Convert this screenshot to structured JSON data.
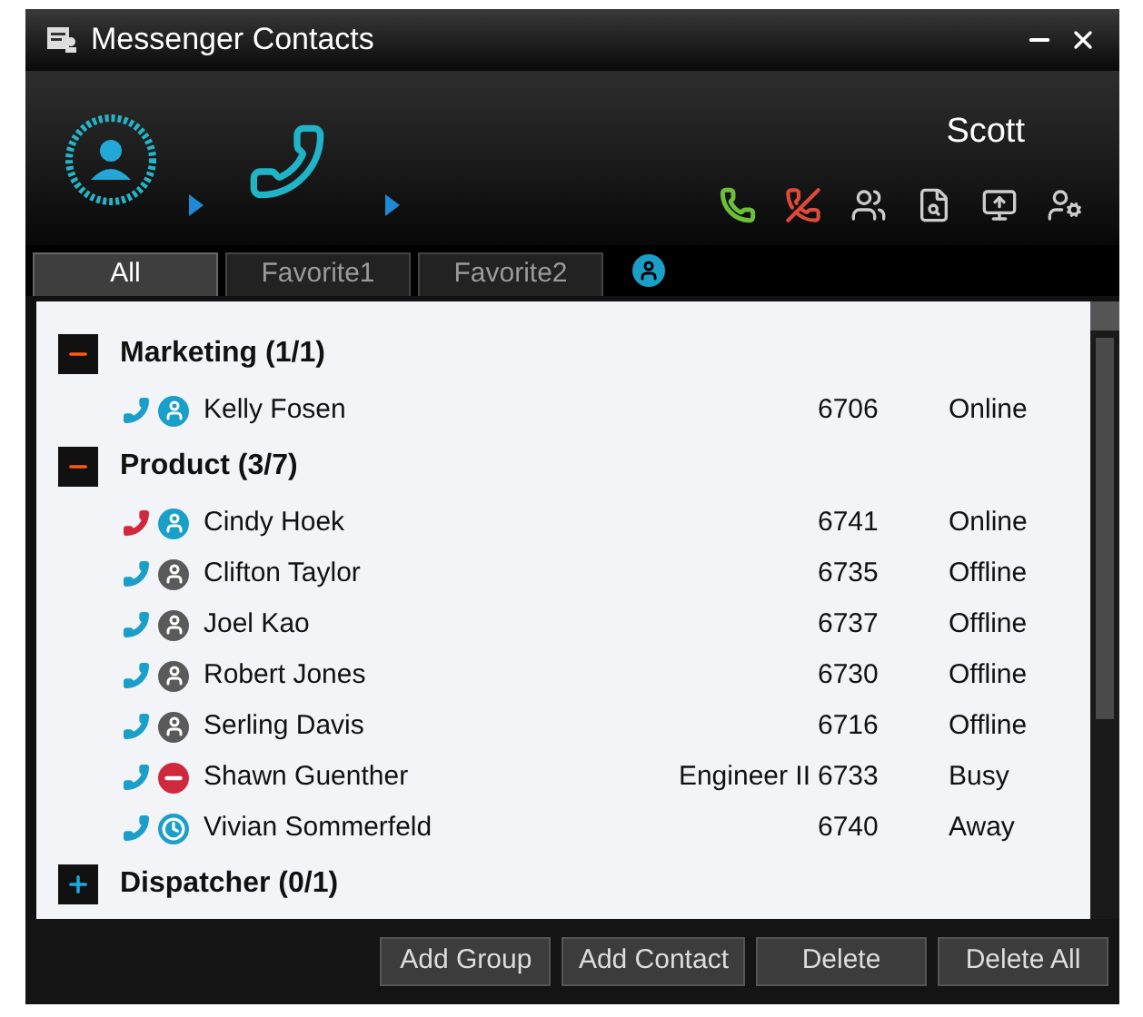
{
  "window": {
    "title": "Messenger Contacts"
  },
  "user": {
    "name": "Scott"
  },
  "tabs": [
    {
      "label": "All",
      "selected": true
    },
    {
      "label": "Favorite1",
      "selected": false
    },
    {
      "label": "Favorite2",
      "selected": false
    }
  ],
  "groups": [
    {
      "name": "Marketing (1/1)",
      "expanded": true,
      "contacts": [
        {
          "name": "Kelly Fosen",
          "ext": "6706",
          "status": "Online",
          "kind": "online",
          "color": "#1a9fc9"
        }
      ]
    },
    {
      "name": "Product (3/7)",
      "expanded": true,
      "contacts": [
        {
          "name": "Cindy Hoek",
          "ext": "6741",
          "status": "Online",
          "kind": "online",
          "color": "#d0283c"
        },
        {
          "name": "Clifton Taylor",
          "ext": "6735",
          "status": "Offline",
          "kind": "offline",
          "color": "#1a9fc9"
        },
        {
          "name": "Joel Kao",
          "ext": "6737",
          "status": "Offline",
          "kind": "offline",
          "color": "#1a9fc9"
        },
        {
          "name": "Robert Jones",
          "ext": "6730",
          "status": "Offline",
          "kind": "offline",
          "color": "#1a9fc9"
        },
        {
          "name": "Serling Davis",
          "ext": "6716",
          "status": "Offline",
          "kind": "offline",
          "color": "#1a9fc9"
        },
        {
          "name": "Shawn Guenther",
          "title": "Engineer II",
          "ext": "6733",
          "status": "Busy",
          "kind": "busy",
          "color": "#1a9fc9"
        },
        {
          "name": "Vivian Sommerfeld",
          "ext": "6740",
          "status": "Away",
          "kind": "away",
          "color": "#1a9fc9"
        }
      ]
    },
    {
      "name": "Dispatcher (0/1)",
      "expanded": false
    }
  ],
  "buttons": [
    "Add Group",
    "Add Contact",
    "Delete",
    "Delete All"
  ]
}
